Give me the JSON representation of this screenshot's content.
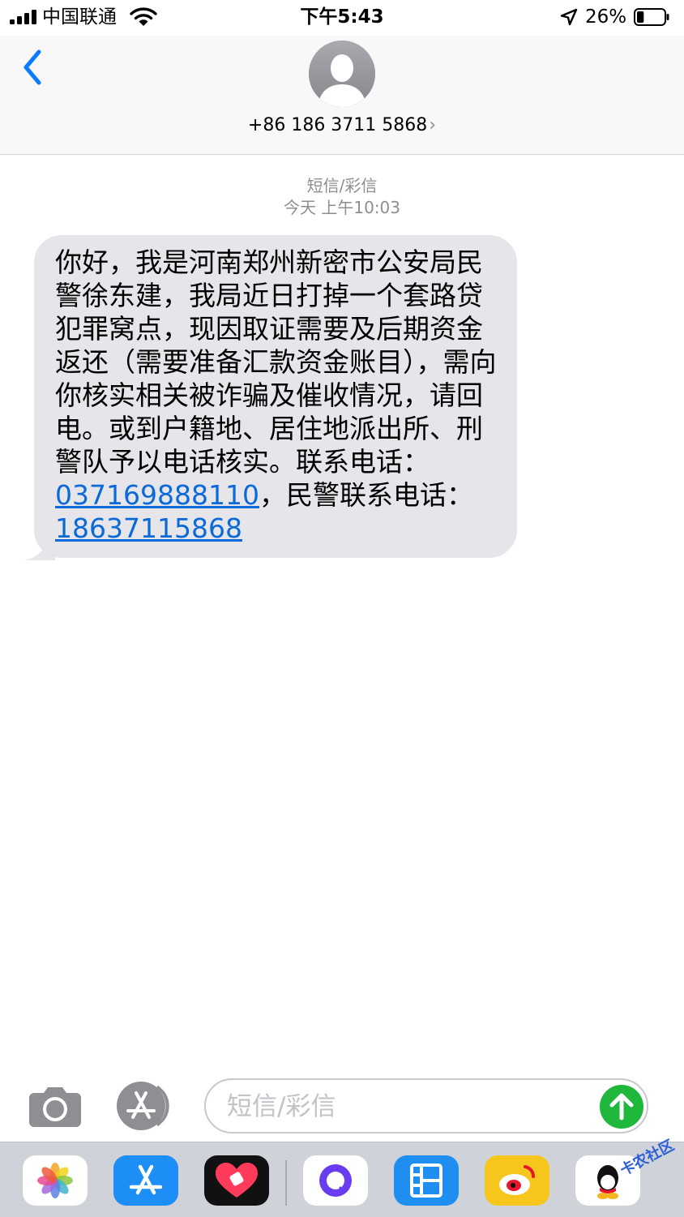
{
  "status_bar": {
    "carrier": "中国联通",
    "time": "下午5:43",
    "battery": "26%",
    "battery_level": 0.26
  },
  "header": {
    "contact": "+86 186 3711 5868",
    "chevron": "›"
  },
  "conversation": {
    "type_label": "短信/彩信",
    "timestamp": "今天 上午10:03",
    "message": {
      "text_before": "你好，我是河南郑州新密市公安局民警徐东建，我局近日打掉一个套路贷犯罪窝点，现因取证需要及后期资金返还（需要准备汇款资金账目），需向你核实相关被诈骗及催收情况，请回电。或到户籍地、居住地派出所、刑警队予以电话核实。联系电话：",
      "link1": "037169888110",
      "text_middle": "，民警联系电话：",
      "link2": "18637115868"
    }
  },
  "input_bar": {
    "placeholder": "短信/彩信"
  },
  "app_drawer": {
    "apps": [
      "photos-app-icon",
      "app-store-app-icon",
      "heart-app-icon",
      "chat-bubble-app-icon",
      "video-app-icon",
      "weibo-app-icon",
      "qq-app-icon"
    ],
    "watermark": "卡农社区"
  },
  "colors": {
    "bubble": "#e5e5ea",
    "link": "#0a6ad8",
    "accent_blue": "#0a7aff",
    "send_green": "#1fb83c",
    "meta_gray": "#8e8e93"
  }
}
